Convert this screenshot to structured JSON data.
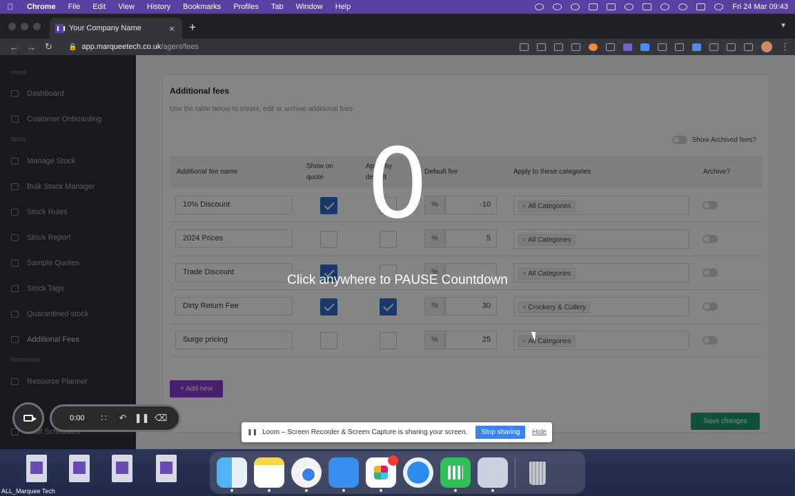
{
  "menubar": {
    "app": "Chrome",
    "items": [
      "File",
      "Edit",
      "View",
      "History",
      "Bookmarks",
      "Profiles",
      "Tab",
      "Window",
      "Help"
    ],
    "clock": "Fri 24 Mar 09:43"
  },
  "browser": {
    "tab_title": "Your Company Name",
    "url_host": "app.marqueetech.co.uk",
    "url_path": "/agent/fees"
  },
  "sidebar": {
    "sections": [
      {
        "heading": "Home",
        "items": [
          "Dashboard",
          "Customer Onboarding"
        ]
      },
      {
        "heading": "Stock",
        "items": [
          "Manage Stock",
          "Bulk Stock Manager",
          "Stock Rules",
          "Stock Report",
          "Sample Quotes",
          "Stock Tags",
          "Quarantined stock",
          "Additional Fees"
        ]
      },
      {
        "heading": "Resources",
        "items": [
          "Resource Planner"
        ]
      }
    ],
    "partial_items": [
      "Staff Schedules"
    ]
  },
  "page": {
    "title": "Additional fees",
    "subtitle": "Use the table below to create, edit or archive additional fees",
    "show_archived_label": "Show Archived fees?",
    "columns": {
      "name": "Additional fee name",
      "show_on_quote_1": "Show on",
      "show_on_quote_2": "quote",
      "apply_default_1": "Apply by",
      "apply_default_2": "default",
      "default_fee": "Default fee",
      "categories": "Apply to these categories",
      "archive": "Archive?"
    },
    "rows": [
      {
        "name": "10% Discount",
        "show_on_quote": true,
        "apply_default": false,
        "unit": "%",
        "fee": "-10",
        "category": "All Categories"
      },
      {
        "name": "2024 Prices",
        "show_on_quote": false,
        "apply_default": false,
        "unit": "%",
        "fee": "5",
        "category": "All Categories"
      },
      {
        "name": "Trade Discount",
        "show_on_quote": true,
        "apply_default": false,
        "unit": "%",
        "fee": "",
        "category": "All Categories"
      },
      {
        "name": "Dirty Return Fee",
        "show_on_quote": true,
        "apply_default": true,
        "unit": "%",
        "fee": "30",
        "category": "Crockery & Cutlery"
      },
      {
        "name": "Surge pricing",
        "show_on_quote": false,
        "apply_default": false,
        "unit": "%",
        "fee": "25",
        "category": "All Categories"
      }
    ],
    "add_button": "+ Add new",
    "save_button": "Save changes"
  },
  "overlay": {
    "countdown": "0",
    "message": "Click anywhere to PAUSE Countdown"
  },
  "loom": {
    "timer": "0:00",
    "banner_message": "Loom – Screen Recorder & Screen Capture is sharing your screen.",
    "stop_button": "Stop sharing",
    "hide_link": "Hide"
  },
  "desktop": {
    "file_label": "ALL_Marquee Tech"
  }
}
